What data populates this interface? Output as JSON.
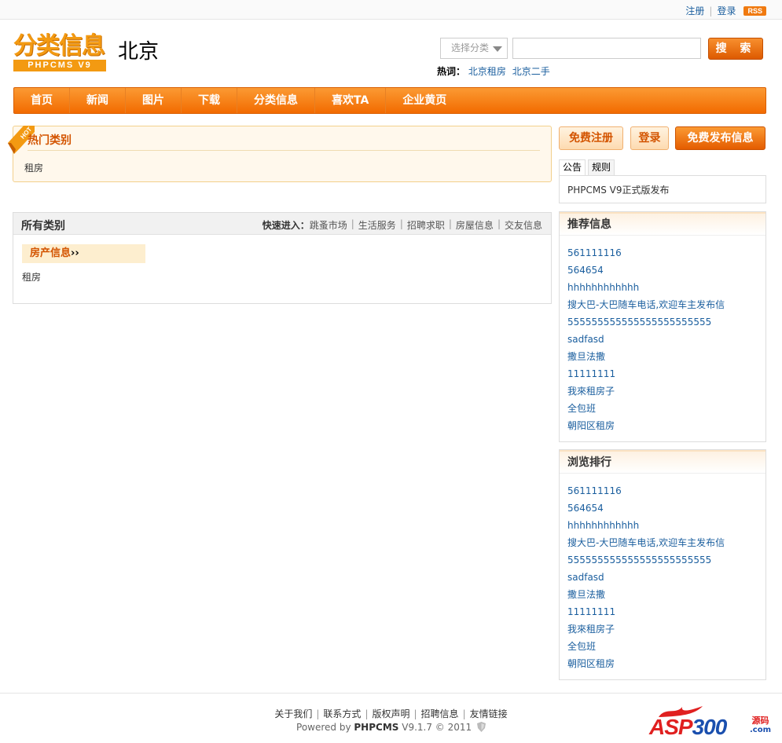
{
  "topbar": {
    "register": "注册",
    "login": "登录",
    "rss": "RSS"
  },
  "logo": {
    "main": "分类信息",
    "sub": "PHPCMS V9"
  },
  "city": "北京",
  "search": {
    "select": "选择分类",
    "input_value": "",
    "button": "搜 索"
  },
  "hot": {
    "label": "热词：",
    "words": [
      "北京租房",
      "北京二手"
    ]
  },
  "nav": [
    "首页",
    "新闻",
    "图片",
    "下载",
    "分类信息",
    "喜欢TA",
    "企业黄页"
  ],
  "hotbox": {
    "ribbon": "HOT",
    "title": "热门类别",
    "content": "租房"
  },
  "allbox": {
    "title": "所有类别",
    "quick_label": "快速进入：",
    "quick": [
      "跳蚤市场",
      "生活服务",
      "招聘求职",
      "房屋信息",
      "交友信息"
    ],
    "category": "房产信息",
    "category_suffix": "››",
    "sub": "租房"
  },
  "actions": {
    "register": "免费注册",
    "login": "登录",
    "post": "免费发布信息"
  },
  "tabs": [
    "公告",
    "规则"
  ],
  "notice": "PHPCMS V9正式版发布",
  "recommend": {
    "title": "推荐信息",
    "items": [
      "561111116",
      "564654",
      "hhhhhhhhhhhh",
      "搜大巴-大巴随车电话,欢迎车主发布信",
      "555555555555555555555555",
      "sadfasd",
      "撒旦法撒",
      "11111111",
      "我來租房子",
      "全包班",
      "朝阳区租房"
    ]
  },
  "ranking": {
    "title": "浏览排行",
    "items": [
      "561111116",
      "564654",
      "hhhhhhhhhhhh",
      "搜大巴-大巴随车电话,欢迎车主发布信",
      "555555555555555555555555",
      "sadfasd",
      "撒旦法撒",
      "11111111",
      "我來租房子",
      "全包班",
      "朝阳区租房"
    ]
  },
  "footer": {
    "links": [
      "关于我们",
      "联系方式",
      "版权声明",
      "招聘信息",
      "友情链接"
    ],
    "powered_prefix": "Powered by ",
    "powered_brand": "PHPCMS",
    "powered_suffix": " V9.1.7 © 2011"
  },
  "watermark": {
    "left": "ASP",
    "right": "300",
    "side": "源码",
    "com": ".com"
  }
}
